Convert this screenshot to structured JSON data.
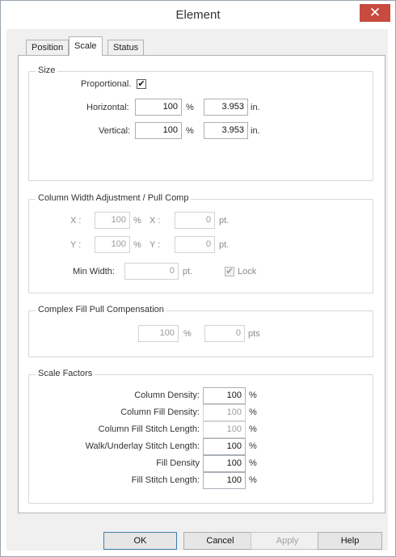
{
  "window": {
    "title": "Element",
    "close_glyph": "✕"
  },
  "tabs": [
    {
      "label": "Position",
      "active": false
    },
    {
      "label": "Scale",
      "active": true
    },
    {
      "label": "Status",
      "active": false
    }
  ],
  "size": {
    "title": "Size",
    "proportional_label": "Proportional.",
    "proportional_checked": true,
    "check_glyph": "✔",
    "horizontal_label": "Horizontal:",
    "horizontal_pct": "100",
    "horizontal_in": "3.953",
    "vertical_label": "Vertical:",
    "vertical_pct": "100",
    "vertical_in": "3.953",
    "pct_unit": "%",
    "in_unit": "in."
  },
  "column": {
    "title": "Column Width Adjustment / Pull Comp",
    "x_label": "X :",
    "x_pct": "100",
    "x2_label": "X :",
    "x_pt": "0",
    "y_label": "Y :",
    "y_pct": "100",
    "y2_label": "Y :",
    "y_pt": "0",
    "pct_unit": "%",
    "pt_unit": "pt.",
    "min_width_label": "Min Width:",
    "min_width_value": "0",
    "lock_label": "Lock",
    "lock_checked": true
  },
  "complex": {
    "title": "Complex Fill Pull Compensation",
    "pct_value": "100",
    "pct_unit": "%",
    "pts_value": "0",
    "pts_unit": "pts"
  },
  "scale_factors": {
    "title": "Scale Factors",
    "unit": "%",
    "rows": [
      {
        "label": "Column Density:",
        "value": "100",
        "enabled": true
      },
      {
        "label": "Column Fill Density:",
        "value": "100",
        "enabled": false
      },
      {
        "label": "Column Fill Stitch Length:",
        "value": "100",
        "enabled": false
      },
      {
        "label": "Walk/Underlay Stitch Length:",
        "value": "100",
        "enabled": true
      },
      {
        "label": "Fill Density",
        "value": "100",
        "enabled": true
      },
      {
        "label": "Fill Stitch Length:",
        "value": "100",
        "enabled": true
      }
    ]
  },
  "buttons": {
    "ok": "OK",
    "cancel": "Cancel",
    "apply": "Apply",
    "help": "Help"
  }
}
